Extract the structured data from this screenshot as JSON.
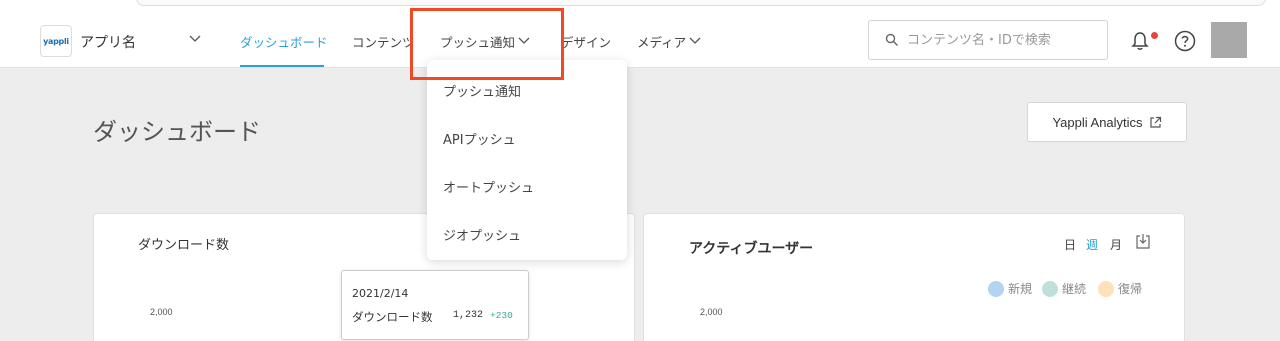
{
  "header": {
    "logo_text": "yappli",
    "app_name": "アプリ名",
    "nav": [
      {
        "label": "ダッシュボード"
      },
      {
        "label": "コンテンツ"
      },
      {
        "label": "プッシュ通知"
      },
      {
        "label": "デザイン"
      },
      {
        "label": "メディア"
      }
    ],
    "search_placeholder": "コンテンツ名・IDで検索",
    "search_value": ""
  },
  "push_dropdown": {
    "items": [
      "プッシュ通知",
      "APIプッシュ",
      "オートプッシュ",
      "ジオプッシュ"
    ]
  },
  "page": {
    "title": "ダッシュボード",
    "analytics_button": "Yappli Analytics"
  },
  "downloads_card": {
    "title": "ダウンロード数",
    "y_tick": "2,000",
    "tooltip": {
      "date": "2021/2/14",
      "label": "ダウンロード数",
      "value": "1,232",
      "delta": "+230"
    }
  },
  "active_users_card": {
    "title": "アクティブユーザー",
    "periods": [
      "日",
      "週",
      "月"
    ],
    "active_period": "週",
    "legend": [
      {
        "label": "新規",
        "color": "#b3d4f0"
      },
      {
        "label": "継続",
        "color": "#bfe0d9"
      },
      {
        "label": "復帰",
        "color": "#fde1b8"
      }
    ],
    "y_tick": "2,000"
  },
  "colors": {
    "accent": "#2a9fd8",
    "highlight": "#f04a24",
    "notification_dot": "#e8453c",
    "delta_positive": "#3aa89a"
  }
}
